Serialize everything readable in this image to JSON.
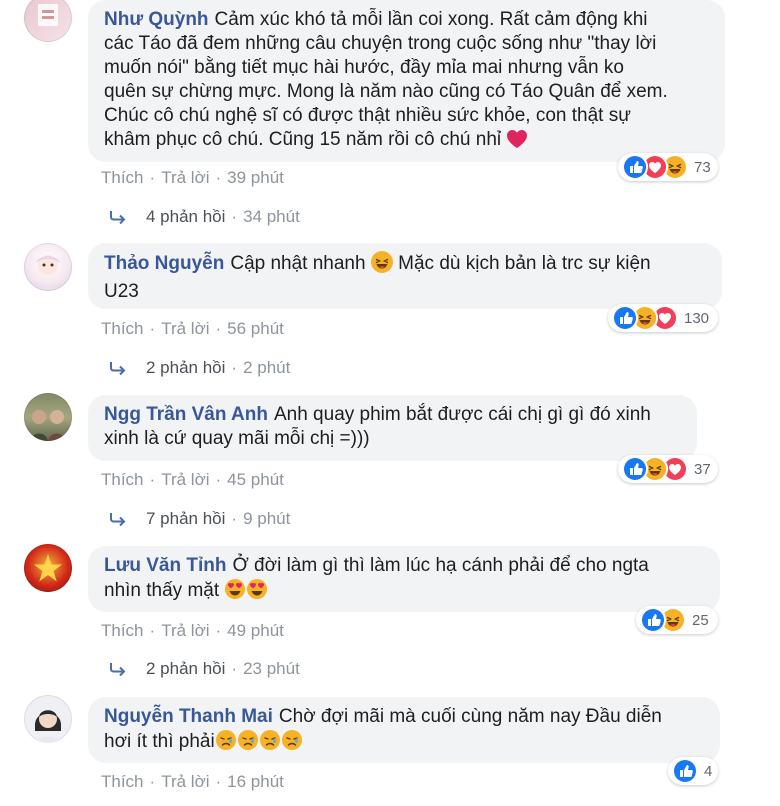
{
  "colors": {
    "author": "#385898",
    "meta": "#8d949e",
    "bubble": "#f2f3f5",
    "like": "#1877f2",
    "love": "#f33e58",
    "haha": "#f7b125"
  },
  "comments": [
    {
      "author": "Như Quỳnh",
      "text_lines": [
        "Cảm xúc khó tả mỗi lần coi xong. Rất cảm động khi",
        "các Táo đã đem những câu chuyện trong cuộc sống như \"thay lời",
        "muốn nói\" bằng tiết mục hài hước, đầy mỉa mai nhưng vẫn ko",
        "quên sự chừng mực. Mong là năm nào cũng có Táo Quân để xem.",
        "Chúc cô chú nghệ sĩ có được thật nhiều sức khỏe, con thật sự",
        "khâm phục cô chú. Cũng 15 năm rồi cô chú nhỉ"
      ],
      "emoji": [
        "heart-emoji"
      ],
      "like_label": "Thích",
      "reply_label": "Trả lời",
      "time": "39 phút",
      "reactions": [
        "like-icon",
        "love-icon",
        "haha-icon"
      ],
      "reaction_count": "73",
      "replies_label": "4 phản hồi",
      "replies_time": "34 phút"
    },
    {
      "author": "Thảo Nguyễn",
      "text_lines": [
        "Cập nhật nhanh",
        "Mặc dù kịch bản là trc sự kiện",
        "U23"
      ],
      "emoji": [
        "laughing-tears-emoji"
      ],
      "like_label": "Thích",
      "reply_label": "Trả lời",
      "time": "56 phút",
      "reactions": [
        "like-icon",
        "haha-icon",
        "love-icon"
      ],
      "reaction_count": "130",
      "replies_label": "2 phản hồi",
      "replies_time": "2 phút"
    },
    {
      "author": "Ngg Trần Vân Anh",
      "text_lines": [
        "Anh quay phim bắt được cái chị gì gì đó xinh",
        "xinh là cứ quay mãi mỗi chị =)))"
      ],
      "like_label": "Thích",
      "reply_label": "Trả lời",
      "time": "45 phút",
      "reactions": [
        "like-icon",
        "haha-icon",
        "love-icon"
      ],
      "reaction_count": "37",
      "replies_label": "7 phản hồi",
      "replies_time": "9 phút"
    },
    {
      "author": "Lưu Văn Tỉnh",
      "text_lines": [
        "Ở đời làm gì thì làm lúc hạ cánh phải để cho ngta",
        "nhìn thấy mặt"
      ],
      "emoji": [
        "heart-eyes-emoji",
        "heart-eyes-emoji"
      ],
      "like_label": "Thích",
      "reply_label": "Trả lời",
      "time": "49 phút",
      "reactions": [
        "like-icon",
        "haha-icon"
      ],
      "reaction_count": "25",
      "replies_label": "2 phản hồi",
      "replies_time": "23 phút"
    },
    {
      "author": "Nguyễn Thanh Mai",
      "text_lines": [
        "Chờ đợi mãi mà cuối cùng năm nay Đầu diễn",
        "hơi ít thì phải"
      ],
      "emoji": [
        "sad-sweat-emoji",
        "sad-sweat-emoji",
        "sad-sweat-emoji",
        "sad-sweat-emoji"
      ],
      "like_label": "Thích",
      "reply_label": "Trả lời",
      "time": "16 phút",
      "reactions": [
        "like-icon"
      ],
      "reaction_count": "4"
    }
  ]
}
